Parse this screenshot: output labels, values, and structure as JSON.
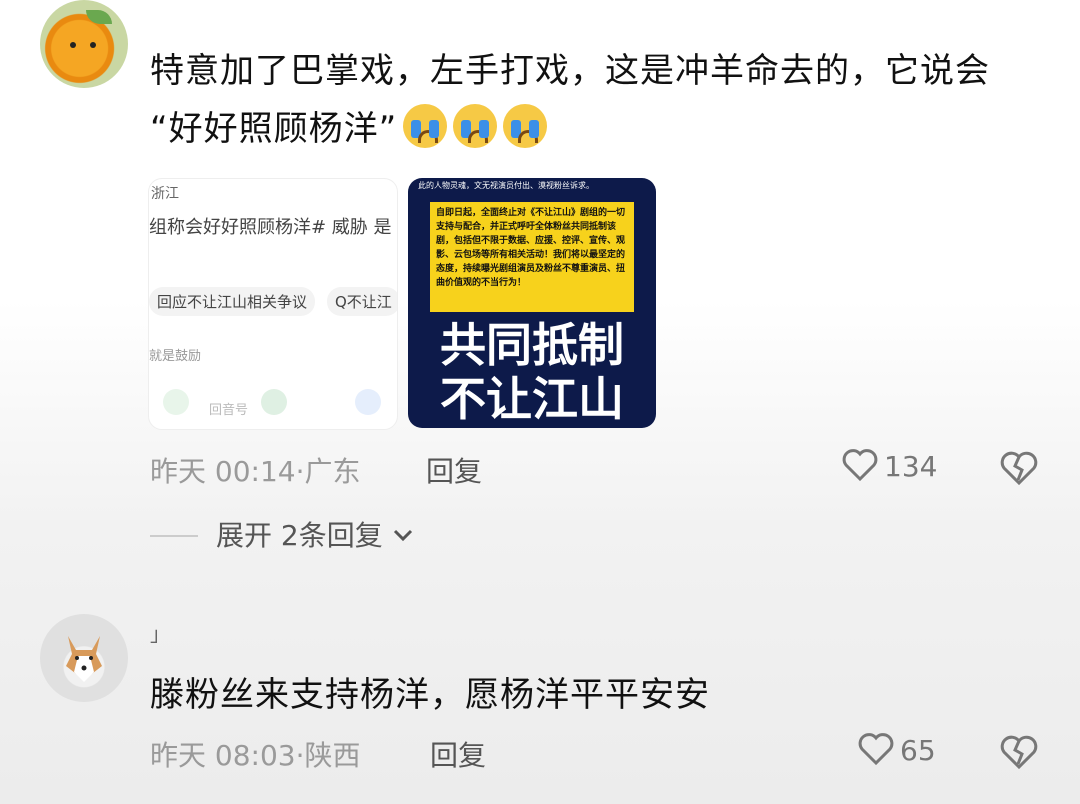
{
  "comments": [
    {
      "text_line1": "特意加了巴掌戏，左手打戏，这是冲羊命去的，它说会",
      "text_line2": "“好好照顾杨洋”",
      "time": "昨天 00:14",
      "location": "广东",
      "reply_label": "回复",
      "like_count": "134",
      "expand_label": "展开 2条回复",
      "images": {
        "img1": {
          "line1": "浙江",
          "line2": "组称会好好照顾杨洋# 威胁 是",
          "chip1": "回应不让江山相关争议",
          "chip2": "Q不让江",
          "line3": "就是鼓励",
          "line4": "回音号"
        },
        "img2": {
          "top": "此的人物灵魂，文无视演员付出、漠视粉丝诉求。",
          "yellow_text": "自即日起，全面终止对《不让江山》剧组的一切支持与配合，并正式呼吁全体粉丝共同抵制该剧，包括但不限于数据、应援、控评、宣传、观影、云包场等所有相关活动！我们将以最坚定的态度，持续曝光剧组演员及粉丝不尊重演员、扭曲价值观的不当行为！",
          "big1": "共同抵制",
          "big2": "不让江山"
        }
      }
    },
    {
      "username": "」",
      "text_line1": "滕粉丝来支持杨洋，愿杨洋平平安安",
      "time": "昨天 08:03",
      "location": "陕西",
      "reply_label": "回复",
      "like_count": "65"
    }
  ],
  "icons": [
    "heart-icon",
    "broken-heart-icon",
    "crying-emoji-icon",
    "chevron-down-icon",
    "wechat-icon",
    "moments-icon",
    "qq-icon"
  ]
}
